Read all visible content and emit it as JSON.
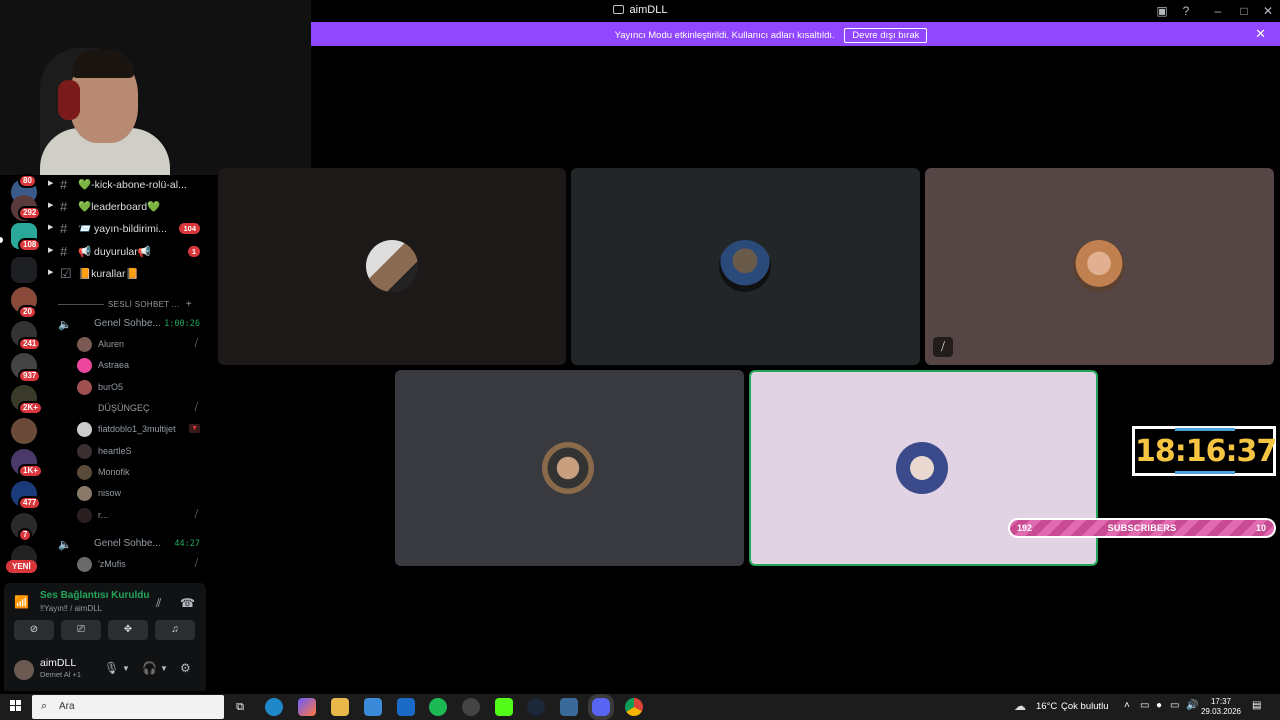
{
  "window": {
    "title": "aimDLL"
  },
  "banner": {
    "message": "Yayıncı Modu etkinleştirildi. Kullanıcı adları kısaltıldı.",
    "button": "Devre dışı bırak",
    "close": "✕"
  },
  "rail": {
    "badges": [
      "80",
      "292",
      "108",
      "20",
      "241",
      "937",
      "2K+",
      "1K+",
      "477",
      "7"
    ],
    "new_label": "YENİ"
  },
  "channels": [
    {
      "name": "💚-kick-abone-rolü-al...",
      "count": ""
    },
    {
      "name": "💚leaderboard💚",
      "count": ""
    },
    {
      "name": "📨 yayın-bildirimi...",
      "count": "104"
    },
    {
      "name": "📢 duyurular📢",
      "count": "1"
    },
    {
      "name": "📙kurallar📙",
      "count": ""
    }
  ],
  "voice_category": "SESLİ SOHBET ...",
  "voice_channels": [
    {
      "name": "Genel Sohbe...",
      "time": "1:00:26"
    },
    {
      "name": "Genel Sohbe...",
      "time": "44:27"
    }
  ],
  "voice_users": [
    {
      "name": "Aluren",
      "muted": true
    },
    {
      "name": "Astraea",
      "muted": false
    },
    {
      "name": "burO5",
      "muted": false
    },
    {
      "name": "DÜŞÜNGEÇ",
      "muted": true
    },
    {
      "name": "fiatdoblo1_3multijet",
      "muted": false
    },
    {
      "name": "heartleS",
      "muted": false
    },
    {
      "name": "Monofik",
      "muted": false
    },
    {
      "name": "nisow",
      "muted": false
    },
    {
      "name": "r...",
      "muted": true
    }
  ],
  "voice_users_2": [
    {
      "name": "'zMufis",
      "muted": true
    }
  ],
  "voice_panel": {
    "title": "Ses Bağlantısı Kuruldu",
    "subtitle": "‼Yayın‼ / aimDLL"
  },
  "user_panel": {
    "name": "aimDLL",
    "status": "Demet Al +1"
  },
  "clock": "18:16:37",
  "subscribers": {
    "current": "192",
    "label": "SUBSCRIBERS",
    "goal": "10"
  },
  "taskbar": {
    "search_placeholder": "Ara",
    "weather_temp": "16°C",
    "weather_desc": "Çok bulutlu",
    "time": "17:37",
    "date": "29.03.2026"
  },
  "colors": {
    "accent": "#9146ff",
    "online": "#23a55a",
    "badge": "#da373c",
    "clock": "#f5c542"
  }
}
